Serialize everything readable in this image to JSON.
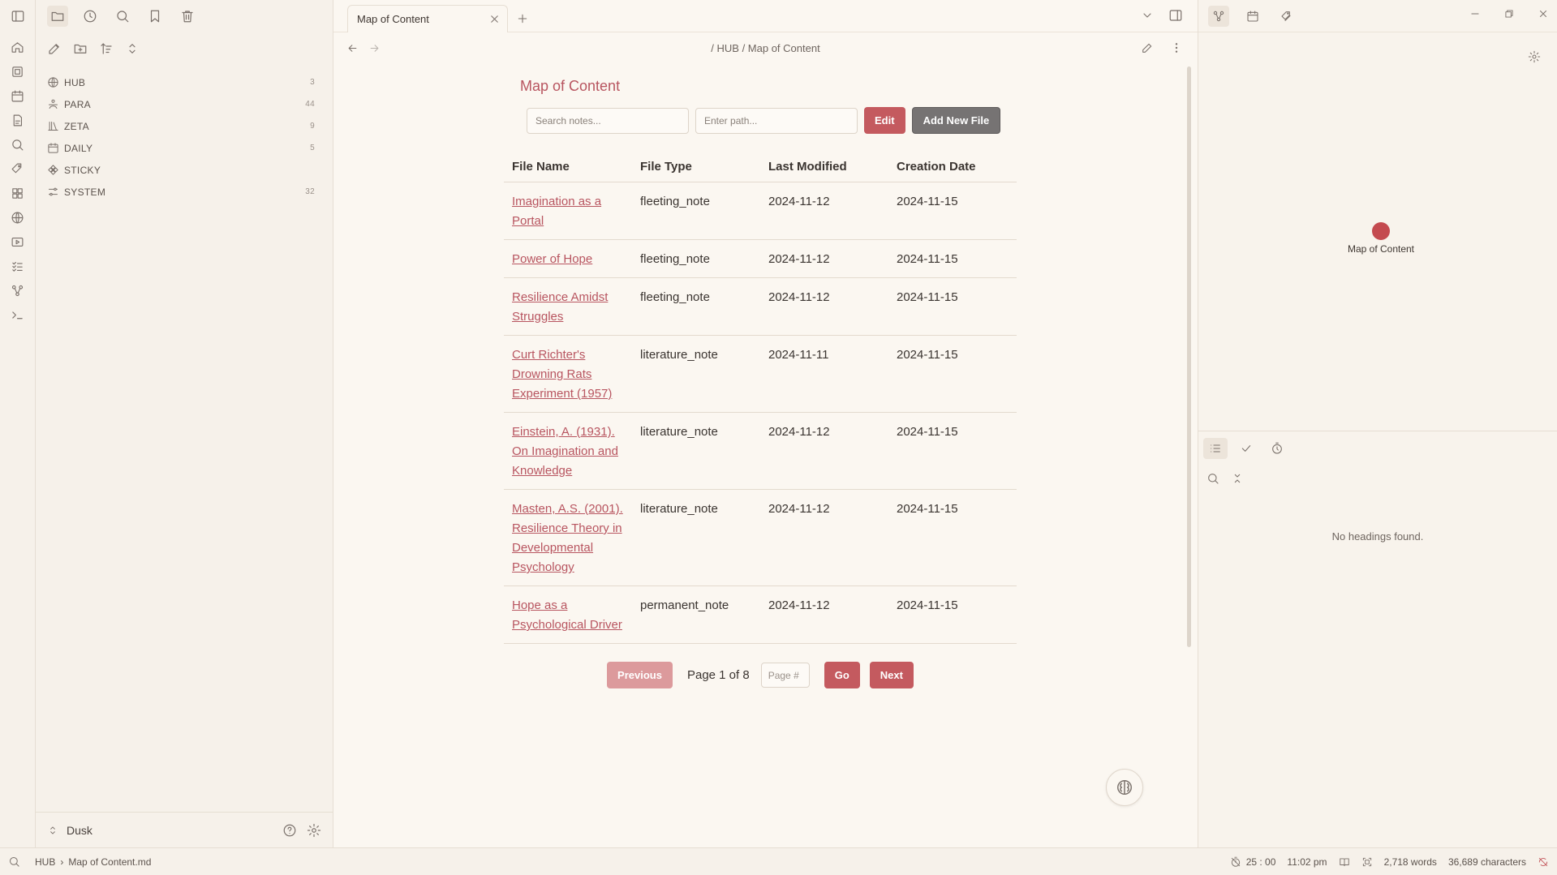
{
  "ribbon": {
    "toggle_icon": "sidebar-left-icon",
    "items": [
      "home-icon",
      "pages-icon",
      "calendar-icon",
      "file-icon",
      "search-icon",
      "tag-pen-icon",
      "grid-icon",
      "globe-icon",
      "slides-icon",
      "checklist-icon",
      "graph-icon",
      "terminal-icon"
    ]
  },
  "left_sidebar": {
    "tabs": [
      "folder-icon",
      "clock-icon",
      "search-icon",
      "bookmark-icon",
      "trash-icon"
    ],
    "actions": [
      "new-note-icon",
      "new-folder-icon",
      "sort-icon",
      "collapse-icon"
    ],
    "folders": [
      {
        "name": "HUB",
        "count": "3",
        "icon": "globe-icon"
      },
      {
        "name": "PARA",
        "count": "44",
        "icon": "para-icon"
      },
      {
        "name": "ZETA",
        "count": "9",
        "icon": "library-icon"
      },
      {
        "name": "DAILY",
        "count": "5",
        "icon": "calendar-icon"
      },
      {
        "name": "STICKY",
        "count": "",
        "icon": "sticky-icon"
      },
      {
        "name": "SYSTEM",
        "count": "32",
        "icon": "settings-sliders-icon"
      }
    ],
    "vault_name": "Dusk"
  },
  "tabs": [
    {
      "label": "Map of Content"
    }
  ],
  "breadcrumb": "/ HUB  /  Map of Content",
  "moc": {
    "title": "Map of Content",
    "search_placeholder": "Search notes...",
    "path_placeholder": "Enter path...",
    "edit_label": "Edit",
    "add_label": "Add New File",
    "columns": [
      "File Name",
      "File Type",
      "Last Modified",
      "Creation Date"
    ],
    "rows": [
      {
        "name": "Imagination as a Portal",
        "type": "fleeting_note",
        "modified": "2024-11-12",
        "created": "2024-11-15"
      },
      {
        "name": "Power of Hope",
        "type": "fleeting_note",
        "modified": "2024-11-12",
        "created": "2024-11-15"
      },
      {
        "name": "Resilience Amidst Struggles",
        "type": "fleeting_note",
        "modified": "2024-11-12",
        "created": "2024-11-15"
      },
      {
        "name": "Curt Richter's Drowning Rats Experiment (1957)",
        "type": "literature_note",
        "modified": "2024-11-11",
        "created": "2024-11-15"
      },
      {
        "name": "Einstein, A. (1931). On Imagination and Knowledge",
        "type": "literature_note",
        "modified": "2024-11-12",
        "created": "2024-11-15"
      },
      {
        "name": "Masten, A.S. (2001). Resilience Theory in Developmental Psychology",
        "type": "literature_note",
        "modified": "2024-11-12",
        "created": "2024-11-15"
      },
      {
        "name": "Hope as a Psychological Driver",
        "type": "permanent_note",
        "modified": "2024-11-12",
        "created": "2024-11-15"
      }
    ],
    "pager": {
      "previous": "Previous",
      "info": "Page 1 of 8",
      "page_placeholder": "Page #",
      "go": "Go",
      "next": "Next"
    }
  },
  "right_sidebar": {
    "tabs": [
      "graph-icon",
      "calendar-icon",
      "tags-icon"
    ],
    "graph_node_label": "Map of Content",
    "outline_tabs": [
      "list-icon",
      "check-icon",
      "timer-icon"
    ],
    "no_headings": "No headings found."
  },
  "statusbar": {
    "crumb_1": "HUB",
    "crumb_2": "Map of Content.md",
    "timer": "25 : 00",
    "time": "11:02 pm",
    "words": "2,718 words",
    "chars": "36,689 characters"
  },
  "colors": {
    "accent": "#c45a5f",
    "link": "#b85560",
    "background": "#fbf7f1",
    "sidebar": "#f6f1ea"
  }
}
